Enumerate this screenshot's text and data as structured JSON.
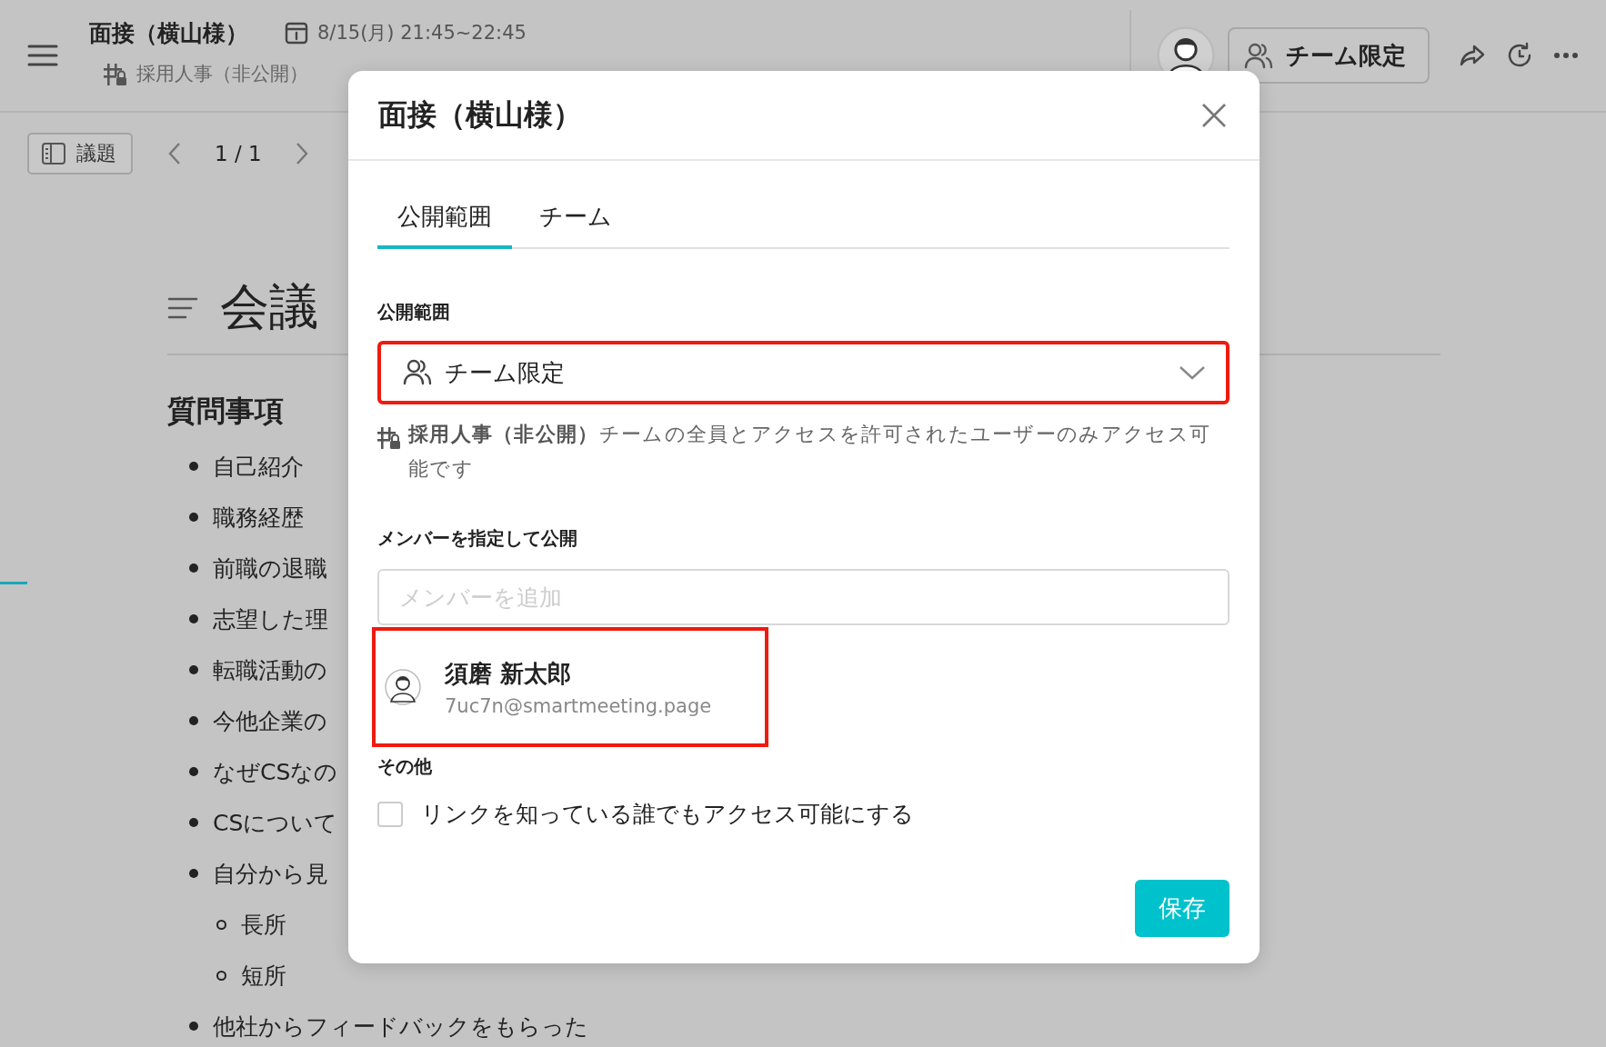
{
  "header": {
    "title": "面接（横山様）",
    "date": "8/15(月) 21:45~22:45",
    "team": "採用人事（非公開）",
    "visibility_button": "チーム限定"
  },
  "toolbar": {
    "agenda_button": "議題",
    "pager": "1 / 1"
  },
  "document": {
    "heading": "会議",
    "section": "質問事項",
    "items": [
      {
        "text": "自己紹介"
      },
      {
        "text": "職務経歴"
      },
      {
        "text": "前職の退職"
      },
      {
        "text": "志望した理"
      },
      {
        "text": "転職活動の"
      },
      {
        "text": "今他企業の"
      },
      {
        "text": "なぜCSなの"
      },
      {
        "text": "CSについて"
      },
      {
        "text": "自分から見",
        "children": [
          {
            "text": "長所"
          },
          {
            "text": "短所"
          }
        ]
      },
      {
        "text": "他社からフィードバックをもらった"
      }
    ]
  },
  "dialog": {
    "title": "面接（横山様）",
    "tabs": [
      {
        "label": "公開範囲",
        "selected": true
      },
      {
        "label": "チーム",
        "selected": false
      }
    ],
    "scope_label": "公開範囲",
    "scope_select": {
      "value": "チーム限定",
      "highlighted": true
    },
    "scope_description": "**採用人事（非公開）**チームの全員とアクセスを許可されたユーザーのみアクセス可能です",
    "members_label": "メンバーを指定して公開",
    "member_field": {
      "placeholder": "メンバーを追加"
    },
    "members": [
      {
        "name": "須磨 新太郎",
        "email": "7uc7n@smartmeeting.page",
        "highlighted": true
      }
    ],
    "other_label": "その他",
    "options": [
      {
        "label": "リンクを知っている誰でもアクセス可能にする",
        "checked": false
      }
    ],
    "save_button": "保存"
  }
}
